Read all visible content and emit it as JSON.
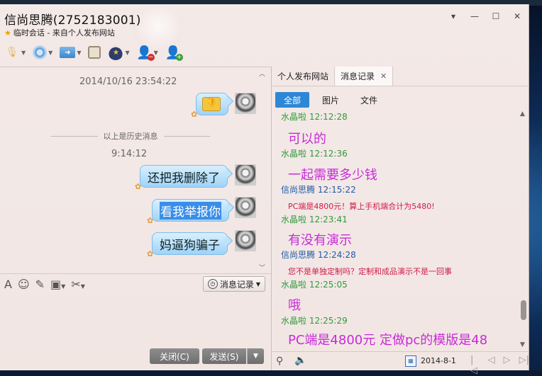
{
  "window": {
    "title": "信尚思腾(2752183001)",
    "subtitle": "临时会话 - 来自个人发布网站"
  },
  "toolbar": {
    "icons": [
      "mic-icon",
      "camera-icon",
      "file-transfer-icon",
      "screen-icon",
      "police-icon",
      "remove-user-icon",
      "add-user-icon"
    ]
  },
  "chat": {
    "timestamp1": "2014/10/16 23:54:22",
    "history_label": "以上是历史消息",
    "timestamp2": "9:14:12",
    "messages": [
      {
        "text": "还把我删除了"
      },
      {
        "text": "看我举报你"
      },
      {
        "text": "妈逼狗骗子"
      }
    ]
  },
  "input": {
    "history_button": "消息记录",
    "close_button": "关闭(C)",
    "send_button": "发送(S)"
  },
  "right_panel": {
    "tabs": [
      {
        "label": "个人发布网站"
      },
      {
        "label": "消息记录"
      }
    ],
    "filters": [
      "全部",
      "图片",
      "文件"
    ],
    "records": [
      {
        "head": "水晶啦 12:12:28",
        "body": "可以的",
        "size": "big",
        "sender": "green"
      },
      {
        "head": "水晶啦 12:12:36",
        "body": "一起需要多少钱",
        "size": "big",
        "sender": "green"
      },
      {
        "head": "信尚思腾 12:15:22",
        "body": "PC端是4800元！算上手机端合计为5480!",
        "size": "small",
        "sender": "blue"
      },
      {
        "head": "水晶啦 12:23:41",
        "body": "有没有演示",
        "size": "big",
        "sender": "green"
      },
      {
        "head": "信尚思腾 12:24:28",
        "body": "您不是单独定制吗？定制和成品演示不是一回事",
        "size": "small",
        "sender": "blue"
      },
      {
        "head": "水晶啦 12:25:05",
        "body": "哦",
        "size": "big",
        "sender": "green"
      },
      {
        "head": "水晶啦 12:25:29",
        "body": "PC端是4800元  定做pc的模版是48",
        "size": "big",
        "sender": "green"
      }
    ],
    "date": "2014-8-1"
  },
  "colors": {
    "accent": "#2e86d6",
    "green_name": "#2f9a3a",
    "blue_name": "#1f5aa8",
    "big_text": "#c82bd8",
    "small_text": "#d11a4a"
  }
}
